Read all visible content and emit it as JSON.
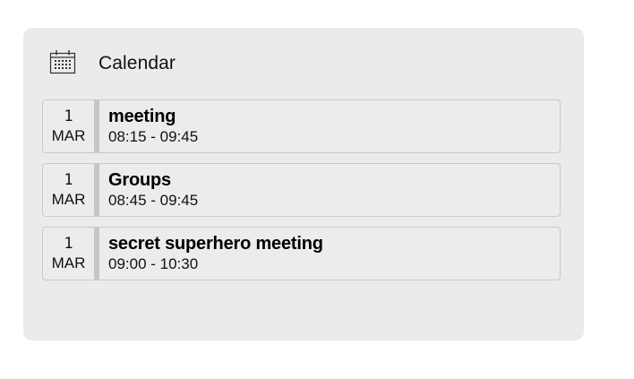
{
  "widget": {
    "title": "Calendar",
    "icon": "calendar-icon"
  },
  "events": [
    {
      "day": "1",
      "month": "MAR",
      "title": "meeting",
      "time": "08:15 - 09:45"
    },
    {
      "day": "1",
      "month": "MAR",
      "title": "Groups",
      "time": "08:45 - 09:45"
    },
    {
      "day": "1",
      "month": "MAR",
      "title": "secret superhero meeting",
      "time": "09:00 - 10:30"
    }
  ],
  "colors": {
    "panel_background": "#ebebeb",
    "event_border": "#c9c9c9",
    "date_divider": "#c6c6c6"
  }
}
